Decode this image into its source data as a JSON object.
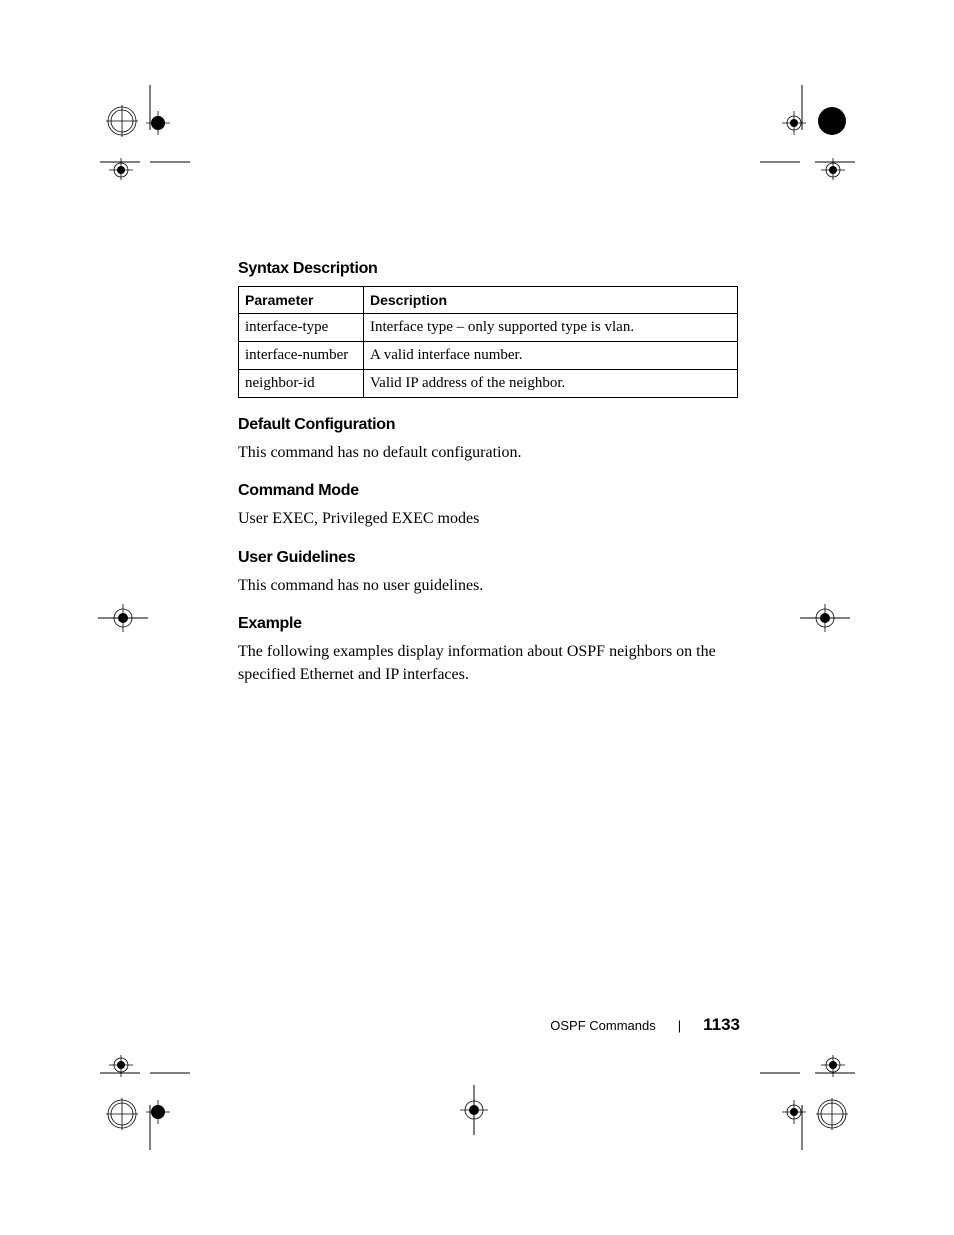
{
  "headings": {
    "syntax": "Syntax Description",
    "default_config": "Default Configuration",
    "command_mode": "Command Mode",
    "user_guidelines": "User Guidelines",
    "example": "Example"
  },
  "table": {
    "header_param": "Parameter",
    "header_desc": "Description",
    "rows": [
      {
        "param": "interface-type",
        "desc": "Interface type – only supported type is vlan."
      },
      {
        "param": "interface-number",
        "desc": "A valid interface number."
      },
      {
        "param": "neighbor-id",
        "desc": "Valid IP address of the neighbor."
      }
    ]
  },
  "body": {
    "default_config": "This command has no default configuration.",
    "command_mode": "User EXEC, Privileged EXEC modes",
    "user_guidelines": "This command has no user guidelines.",
    "example": "The following examples display information about OSPF neighbors on the specified Ethernet and IP interfaces."
  },
  "footer": {
    "section": "OSPF Commands",
    "page": "1133"
  }
}
